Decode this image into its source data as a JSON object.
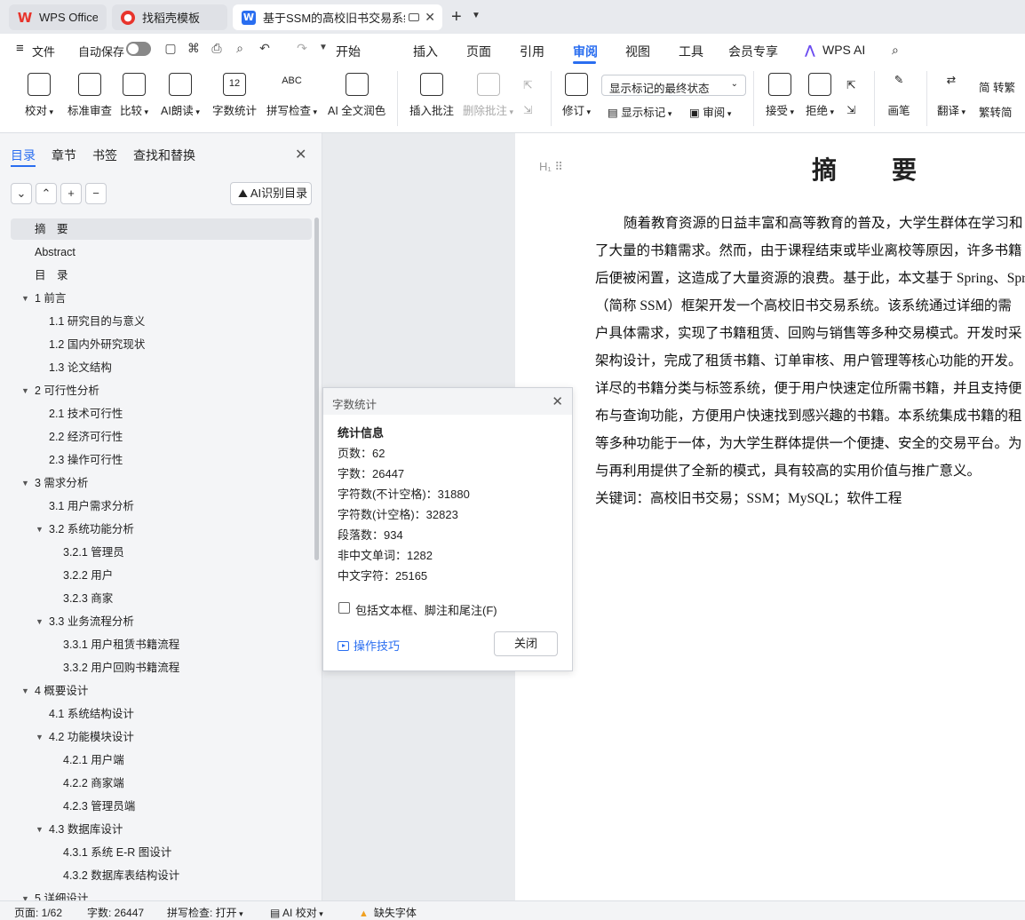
{
  "tabs": {
    "wps": "WPS Office",
    "templates": "找稻壳模板",
    "document": "基于SSM的高校旧书交易系统"
  },
  "menubar": {
    "file": "文件",
    "autosave": "自动保存",
    "items": [
      "开始",
      "插入",
      "页面",
      "引用",
      "审阅",
      "视图",
      "工具",
      "会员专享"
    ],
    "active": "审阅",
    "wps_ai": "WPS AI"
  },
  "ribbon": {
    "proofread": "校对",
    "standard_review": "标准审查",
    "compare": "比较",
    "ai_read": "AI朗读",
    "word_count": "字数统计",
    "spell_check": "拼写检查",
    "ai_polish": "AI 全文润色",
    "insert_comment": "插入批注",
    "delete_comment": "删除批注",
    "track_changes": "修订",
    "markup_mode": "显示标记的最终状态",
    "show_markup": "显示标记",
    "review": "审阅",
    "accept": "接受",
    "reject": "拒绝",
    "pen": "画笔",
    "translate": "翻译",
    "to_traditional": "转繁",
    "to_simplified": "繁转简",
    "icon_texts": {
      "word_count": "12",
      "spell_check": "ABC"
    }
  },
  "nav": {
    "tabs": [
      "目录",
      "章节",
      "书签",
      "查找和替换"
    ],
    "ai_toc": "AI识别目录",
    "toc": [
      {
        "label": "摘　要",
        "level": 0,
        "arrow": "",
        "selected": true
      },
      {
        "label": "Abstract",
        "level": 0,
        "arrow": ""
      },
      {
        "label": "目　录",
        "level": 0,
        "arrow": ""
      },
      {
        "label": "1 前言",
        "level": 0,
        "arrow": "▼"
      },
      {
        "label": "1.1 研究目的与意义",
        "level": 1,
        "arrow": ""
      },
      {
        "label": "1.2 国内外研究现状",
        "level": 1,
        "arrow": ""
      },
      {
        "label": "1.3 论文结构",
        "level": 1,
        "arrow": ""
      },
      {
        "label": "2 可行性分析",
        "level": 0,
        "arrow": "▼"
      },
      {
        "label": "2.1 技术可行性",
        "level": 1,
        "arrow": ""
      },
      {
        "label": "2.2 经济可行性",
        "level": 1,
        "arrow": ""
      },
      {
        "label": "2.3 操作可行性",
        "level": 1,
        "arrow": ""
      },
      {
        "label": "3 需求分析",
        "level": 0,
        "arrow": "▼"
      },
      {
        "label": "3.1 用户需求分析",
        "level": 1,
        "arrow": ""
      },
      {
        "label": "3.2 系统功能分析",
        "level": 1,
        "arrow": "▼"
      },
      {
        "label": "3.2.1 管理员",
        "level": 2,
        "arrow": ""
      },
      {
        "label": "3.2.2 用户",
        "level": 2,
        "arrow": ""
      },
      {
        "label": "3.2.3 商家",
        "level": 2,
        "arrow": ""
      },
      {
        "label": "3.3 业务流程分析",
        "level": 1,
        "arrow": "▼"
      },
      {
        "label": "3.3.1 用户租赁书籍流程",
        "level": 2,
        "arrow": ""
      },
      {
        "label": "3.3.2 用户回购书籍流程",
        "level": 2,
        "arrow": ""
      },
      {
        "label": "4 概要设计",
        "level": 0,
        "arrow": "▼"
      },
      {
        "label": "4.1 系统结构设计",
        "level": 1,
        "arrow": ""
      },
      {
        "label": "4.2 功能模块设计",
        "level": 1,
        "arrow": "▼"
      },
      {
        "label": "4.2.1 用户端",
        "level": 2,
        "arrow": ""
      },
      {
        "label": "4.2.2 商家端",
        "level": 2,
        "arrow": ""
      },
      {
        "label": "4.2.3 管理员端",
        "level": 2,
        "arrow": ""
      },
      {
        "label": "4.3 数据库设计",
        "level": 1,
        "arrow": "▼"
      },
      {
        "label": "4.3.1 系统 E-R 图设计",
        "level": 2,
        "arrow": ""
      },
      {
        "label": "4.3.2 数据库表结构设计",
        "level": 2,
        "arrow": ""
      },
      {
        "label": "5 详细设计",
        "level": 0,
        "arrow": "▼"
      }
    ]
  },
  "document": {
    "title": "摘要",
    "lines": [
      "随着教育资源的日益丰富和高等教育的普及，大学生群体在学习和",
      "了大量的书籍需求。然而，由于课程结束或毕业离校等原因，许多书籍",
      "后便被闲置，这造成了大量资源的浪费。基于此，本文基于 Spring、Spring",
      "（简称 SSM）框架开发一个高校旧书交易系统。该系统通过详细的需",
      "户具体需求，实现了书籍租赁、回购与销售等多种交易模式。开发时采",
      "架构设计，完成了租赁书籍、订单审核、用户管理等核心功能的开发。",
      "详尽的书籍分类与标签系统，便于用户快速定位所需书籍，并且支持便",
      "布与查询功能，方便用户快速找到感兴趣的书籍。本系统集成书籍的租",
      "等多种功能于一体，为大学生群体提供一个便捷、安全的交易平台。为",
      "与再利用提供了全新的模式，具有较高的实用价值与推广意义。"
    ],
    "keywords": "关键词：高校旧书交易；SSM；MySQL；软件工程"
  },
  "dialog": {
    "title": "字数统计",
    "section": "统计信息",
    "stats": [
      "页数：62",
      "字数：26447",
      "字符数(不计空格)：31880",
      "字符数(计空格)：32823",
      "段落数：934",
      "非中文单词：1282",
      "中文字符：25165"
    ],
    "checkbox_label": "包括文本框、脚注和尾注(F)",
    "checkbox_checked": false,
    "tips": "操作技巧",
    "close": "关闭"
  },
  "statusbar": {
    "page": "页面: 1/62",
    "words": "字数: 26447",
    "spell": "拼写检查: 打开",
    "ai_proof": "AI 校对",
    "missing_font": "缺失字体"
  },
  "colors": {
    "accent": "#2a6ef0",
    "warning": "#f0a020"
  }
}
